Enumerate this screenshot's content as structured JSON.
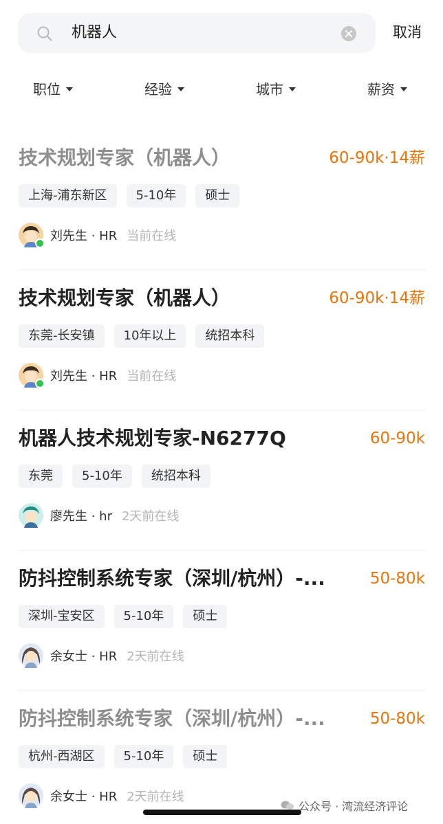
{
  "search": {
    "query": "机器人",
    "cancel_label": "取消"
  },
  "filters": [
    "职位",
    "经验",
    "城市",
    "薪资"
  ],
  "jobs": [
    {
      "title": "技术规划专家（机器人）",
      "salary": "60-90k·14薪",
      "tags": [
        "上海-浦东新区",
        "5-10年",
        "硕士"
      ],
      "recruiter": "刘先生 · HR",
      "status": "当前在线",
      "faded": true
    },
    {
      "title": "技术规划专家（机器人）",
      "salary": "60-90k·14薪",
      "tags": [
        "东莞-长安镇",
        "10年以上",
        "统招本科"
      ],
      "recruiter": "刘先生 · HR",
      "status": "当前在线",
      "faded": false
    },
    {
      "title": "机器人技术规划专家-N6277Q",
      "salary": "60-90k",
      "tags": [
        "东莞",
        "5-10年",
        "统招本科"
      ],
      "recruiter": "廖先生 · hr",
      "status": "2天前在线",
      "faded": false
    },
    {
      "title": "防抖控制系统专家（深圳/杭州）-...",
      "salary": "50-80k",
      "tags": [
        "深圳-宝安区",
        "5-10年",
        "硕士"
      ],
      "recruiter": "余女士 · HR",
      "status": "2天前在线",
      "faded": false
    },
    {
      "title": "防抖控制系统专家（深圳/杭州）-...",
      "salary": "50-80k",
      "tags": [
        "杭州-西湖区",
        "5-10年",
        "硕士"
      ],
      "recruiter": "余女士 · HR",
      "status": "2天前在线",
      "faded": true
    }
  ],
  "watermark": "公众号 · 湾流经济评论",
  "colors": {
    "salary": "#e8740c",
    "online": "#33c24d",
    "tag_bg": "#f3f4f6",
    "search_bg": "#f4f5f7"
  }
}
